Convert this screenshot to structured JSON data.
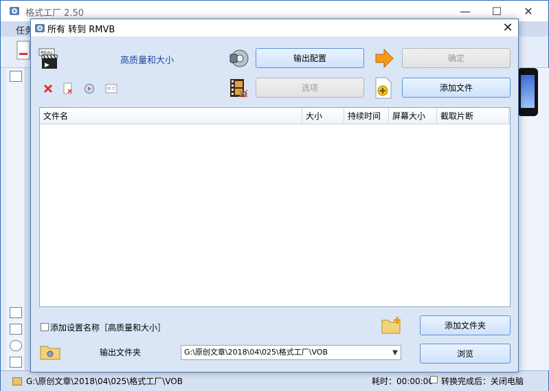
{
  "main_window": {
    "title": "格式工厂 2.50",
    "menu_task": "任务",
    "minimize": "—",
    "maximize": "☐",
    "close": "✕"
  },
  "status_bar": {
    "path": "G:\\原创文章\\2018\\04\\025\\格式工厂\\VOB",
    "elapsed": "耗时：00:00:00",
    "after_convert": "转换完成后：关闭电脑"
  },
  "dialog": {
    "title": "所有 转到 RMVB",
    "close": "✕",
    "profile_name": "高质量和大小",
    "output_config_button": "输出配置",
    "ok_button": "确定",
    "options_button": "选项",
    "add_file_button": "添加文件",
    "table_headers": [
      "文件名",
      "大小",
      "持续时间",
      "屏幕大小",
      "截取片断"
    ],
    "add_name_label": "添加设置名称［高质量和大小］",
    "add_folder_button": "添加文件夹",
    "output_folder_label": "输出文件夹",
    "output_path": "G:\\原创文章\\2018\\04\\025\\格式工厂\\VOB",
    "browse_button": "浏览"
  }
}
